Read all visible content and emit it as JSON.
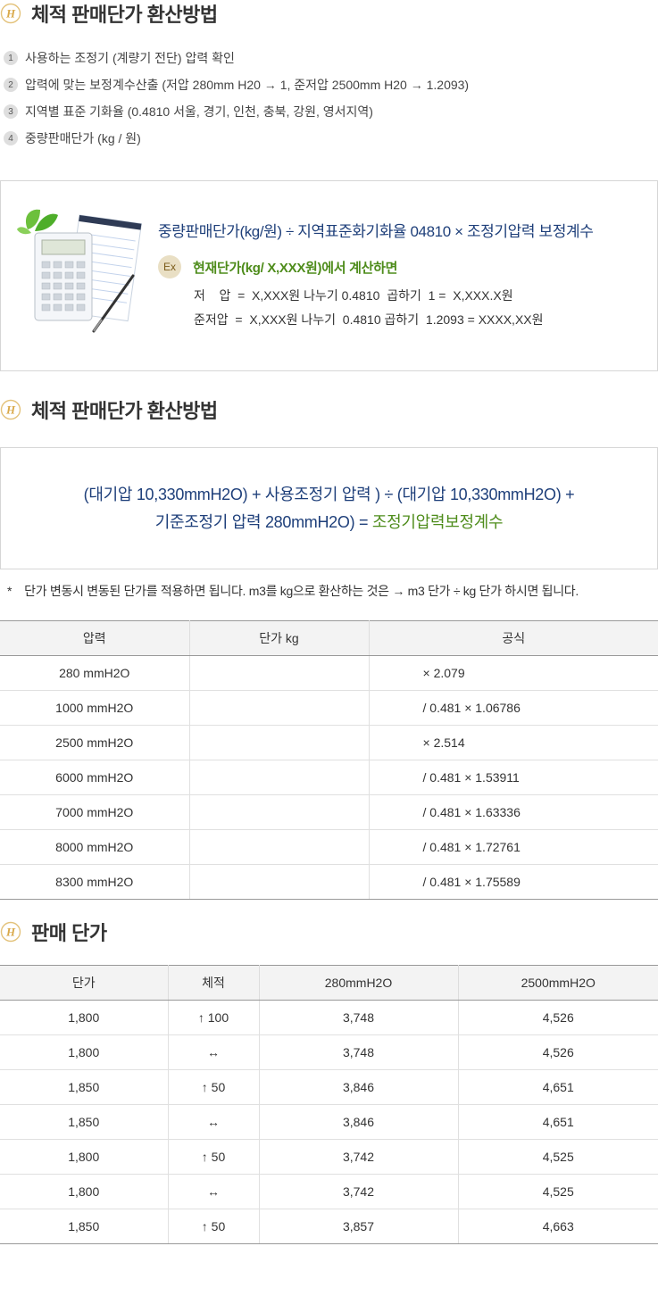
{
  "section1": {
    "title": "체적 판매단가 환산방법",
    "steps": [
      {
        "num": "1",
        "text": "사용하는 조정기 (계량기 전단) 압력 확인"
      },
      {
        "num": "2",
        "text": "압력에 맞는 보정계수산출 (저압 280mm H20 → 1, 준저압 2500mm H20 → 1.2093)"
      },
      {
        "num": "3",
        "text": "지역별 표준 기화율 (0.4810 서울, 경기, 인천, 충북, 강원, 영서지역)"
      },
      {
        "num": "4",
        "text": "중량판매단가 (kg /  원)"
      }
    ]
  },
  "formula_box": {
    "main": "중량판매단가(kg/원) ÷ 지역표준화기화율 04810 × 조정기압력 보정계수",
    "ex_badge": "Ex",
    "ex_title": "현재단가(kg/ X,XXX원)에서 계산하면",
    "line1": "저    압  =  X,XXX원 나누기 0.4810  곱하기  1 =  X,XXX.X원",
    "line2": "준저압  =  X,XXX원 나누기  0.4810 곱하기  1.2093 = XXXX,XX원"
  },
  "section2": {
    "title": "체적 판매단가 환산방법",
    "formula_line1": "(대기압 10,330mmH2O) + 사용조정기 압력 ) ÷ (대기압 10,330mmH2O) +",
    "formula_line2a": "기준조정기 압력 280mmH2O) = ",
    "formula_line2b": "조정기압력보정계수"
  },
  "note": {
    "star": "*",
    "text": "단가 변동시 변동된 단가를 적용하면 됩니다.  m3를 kg으로 환산하는 것은  →   m3 단가 ÷ kg 단가 하시면 됩니다."
  },
  "table1": {
    "headers": [
      "압력",
      "단가 kg",
      "공식"
    ],
    "rows": [
      [
        "280 mmH2O",
        "",
        "× 2.079"
      ],
      [
        "1000 mmH2O",
        "",
        "/ 0.481 × 1.06786"
      ],
      [
        "2500 mmH2O",
        "",
        "× 2.514"
      ],
      [
        "6000 mmH2O",
        "",
        "/ 0.481 × 1.53911"
      ],
      [
        "7000 mmH2O",
        "",
        "/ 0.481 × 1.63336"
      ],
      [
        "8000 mmH2O",
        "",
        "/ 0.481 × 1.72761"
      ],
      [
        "8300 mmH2O",
        "",
        "/ 0.481 × 1.75589"
      ]
    ]
  },
  "section3": {
    "title": "판매 단가"
  },
  "table2": {
    "headers": [
      "단가",
      "체적",
      "280mmH2O",
      "2500mmH2O"
    ],
    "rows": [
      [
        "1,800",
        "↑ 100",
        "3,748",
        "4,526"
      ],
      [
        "1,800",
        "↔",
        "3,748",
        "4,526"
      ],
      [
        "1,850",
        "↑ 50",
        "3,846",
        "4,651"
      ],
      [
        "1,850",
        "↔",
        "3,846",
        "4,651"
      ],
      [
        "1,800",
        "↑ 50",
        "3,742",
        "4,525"
      ],
      [
        "1,800",
        "↔",
        "3,742",
        "4,525"
      ],
      [
        "1,850",
        "↑ 50",
        "3,857",
        "4,663"
      ]
    ]
  }
}
